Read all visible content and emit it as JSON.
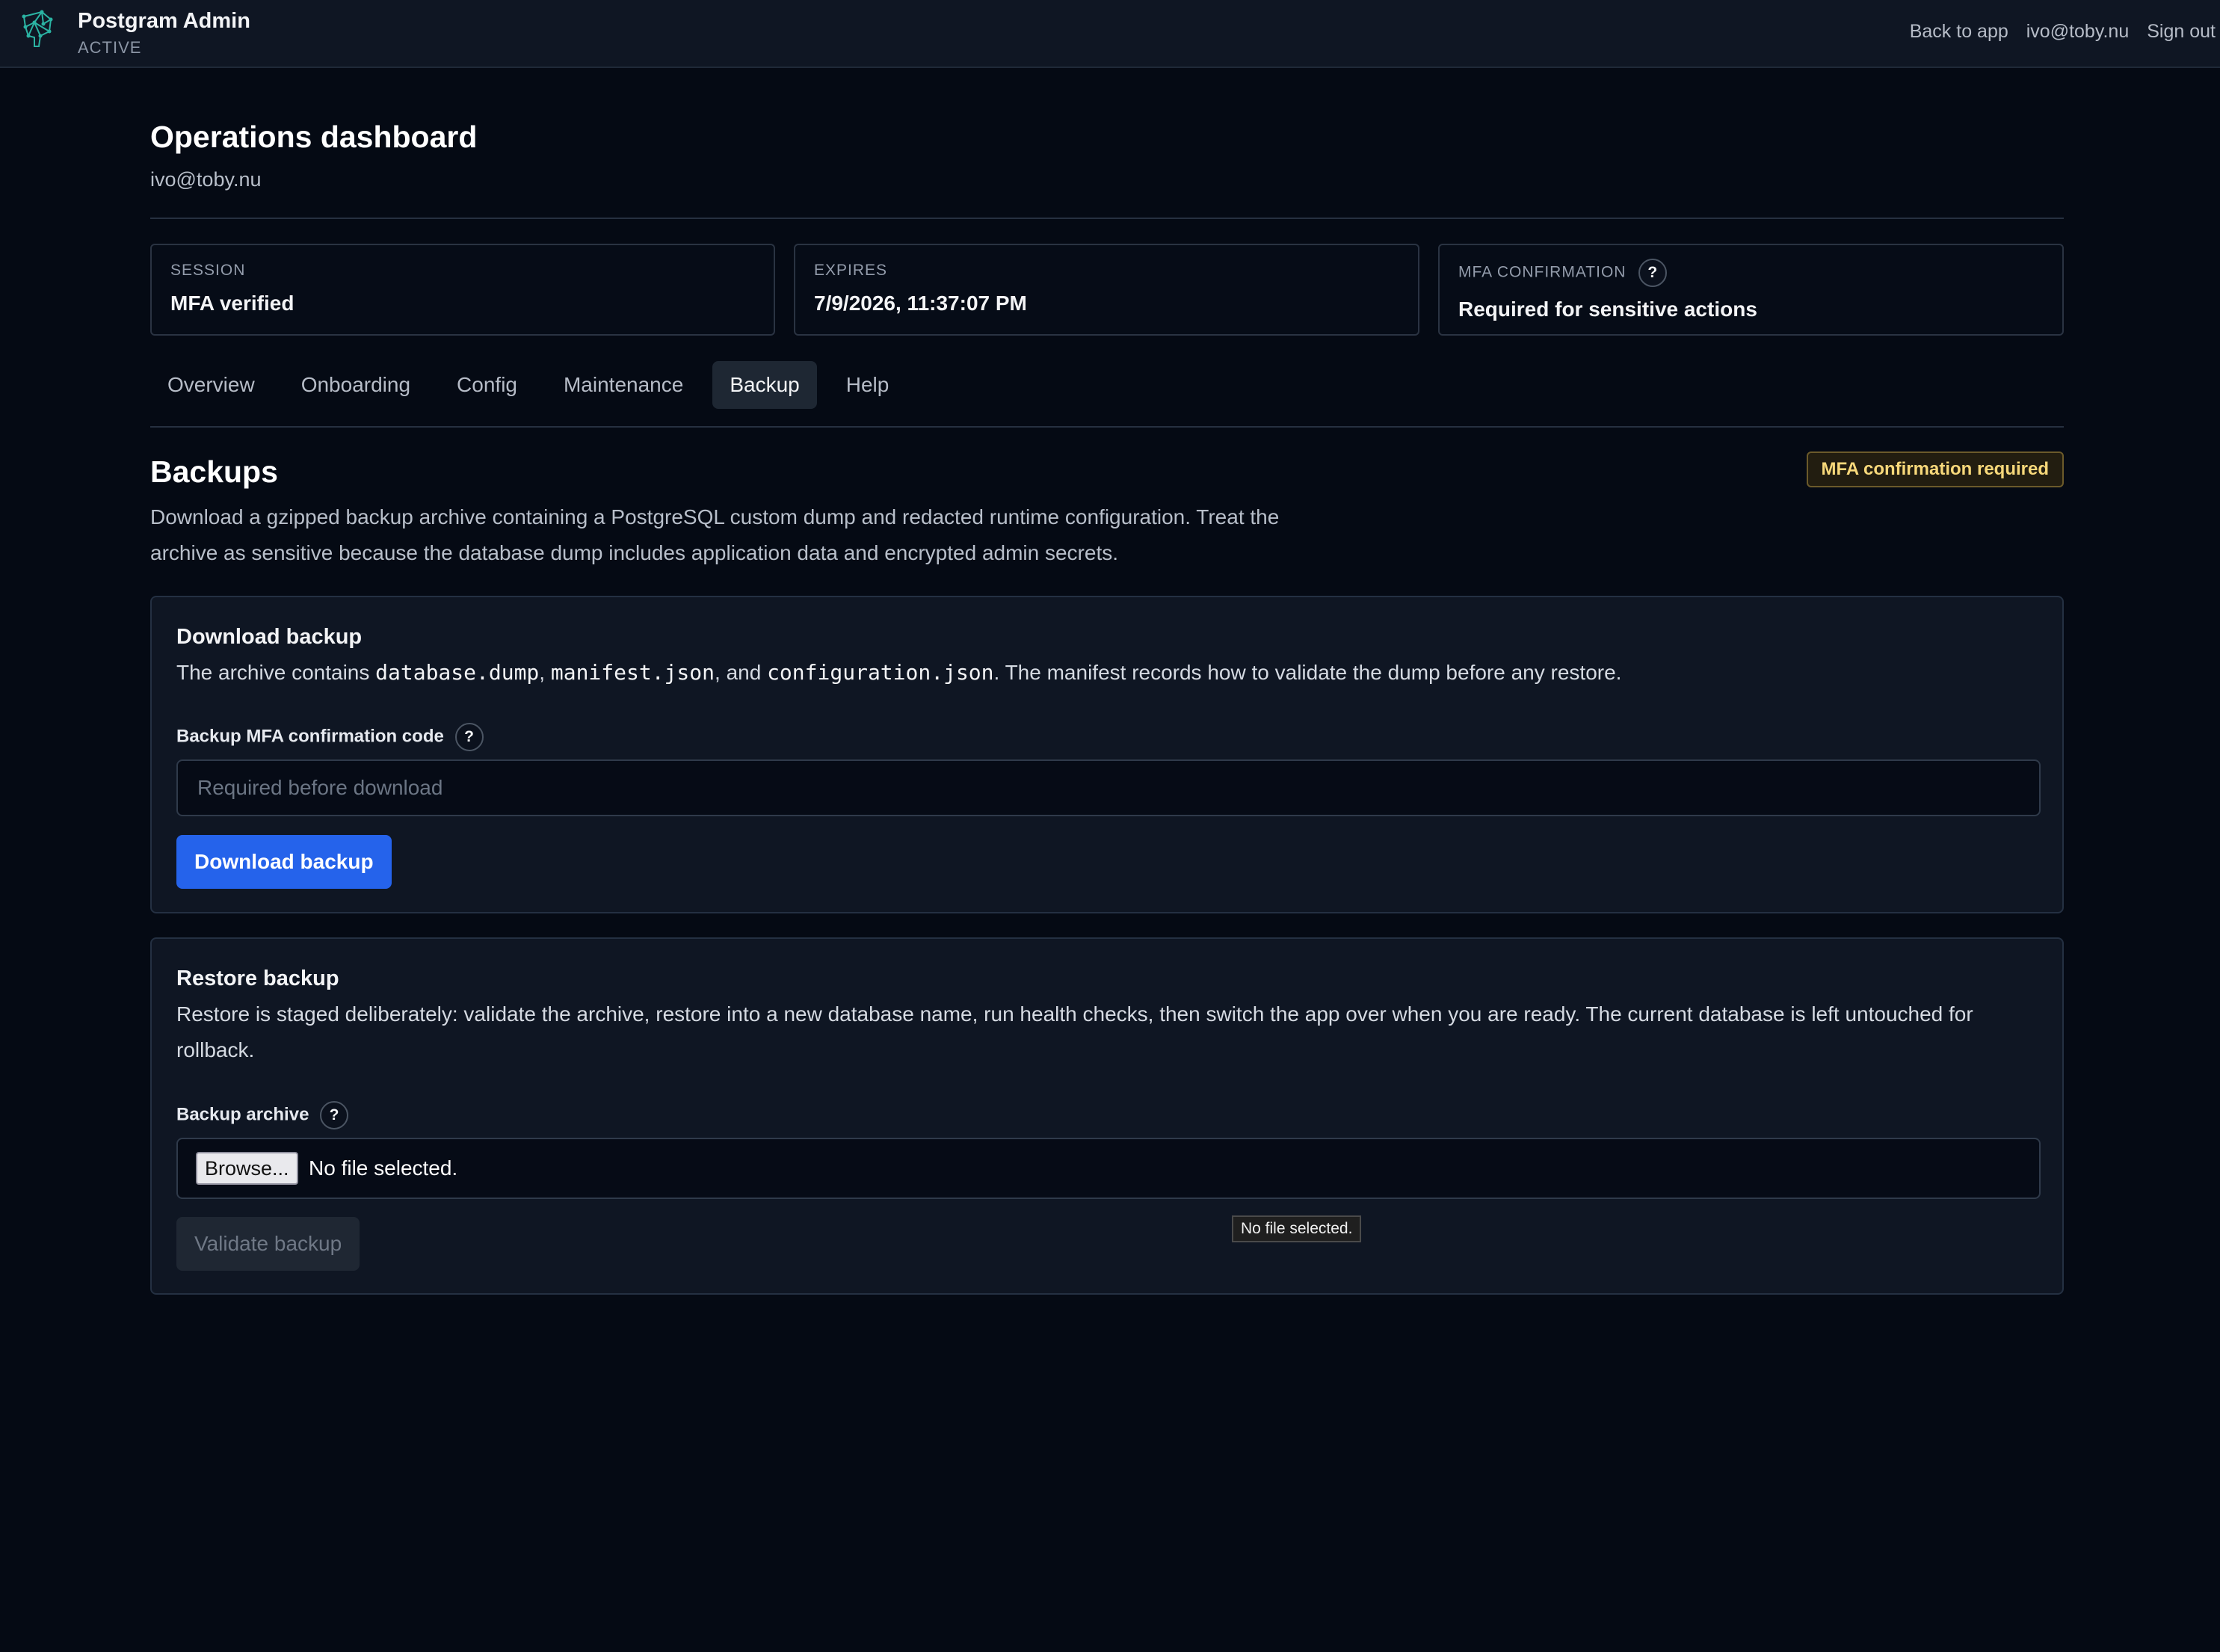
{
  "app": {
    "title": "Postgram Admin",
    "status": "ACTIVE"
  },
  "topnav": {
    "back": "Back to app",
    "user": "ivo@toby.nu",
    "signout": "Sign out"
  },
  "page": {
    "title": "Operations dashboard",
    "subtitle": "ivo@toby.nu"
  },
  "stats": [
    {
      "label": "SESSION",
      "value": "MFA verified"
    },
    {
      "label": "EXPIRES",
      "value": "7/9/2026, 11:37:07 PM"
    },
    {
      "label": "MFA CONFIRMATION",
      "value": "Required for sensitive actions"
    }
  ],
  "tabs": [
    {
      "label": "Overview"
    },
    {
      "label": "Onboarding"
    },
    {
      "label": "Config"
    },
    {
      "label": "Maintenance"
    },
    {
      "label": "Backup",
      "active": true
    },
    {
      "label": "Help"
    }
  ],
  "section": {
    "title": "Backups",
    "badge": "MFA confirmation required",
    "description": "Download a gzipped backup archive containing a PostgreSQL custom dump and redacted runtime configuration. Treat the archive as sensitive because the database dump includes application data and encrypted admin secrets."
  },
  "download": {
    "title": "Download backup",
    "desc_prefix": "The archive contains ",
    "file1": "database.dump",
    "sep1": ", ",
    "file2": "manifest.json",
    "sep2": ", and ",
    "file3": "configuration.json",
    "desc_suffix": ". The manifest records how to validate the dump before any restore.",
    "field_label": "Backup MFA confirmation code",
    "placeholder": "Required before download",
    "button": "Download backup"
  },
  "restore": {
    "title": "Restore backup",
    "description": "Restore is staged deliberately: validate the archive, restore into a new database name, run health checks, then switch the app over when you are ready. The current database is left untouched for rollback.",
    "field_label": "Backup archive",
    "browse": "Browse...",
    "file_status": "No file selected.",
    "button": "Validate backup",
    "tooltip": "No file selected."
  },
  "help_glyph": "?",
  "colors": {
    "primary": "#2563eb",
    "badge": "#f7d87a",
    "background": "#050a14"
  }
}
